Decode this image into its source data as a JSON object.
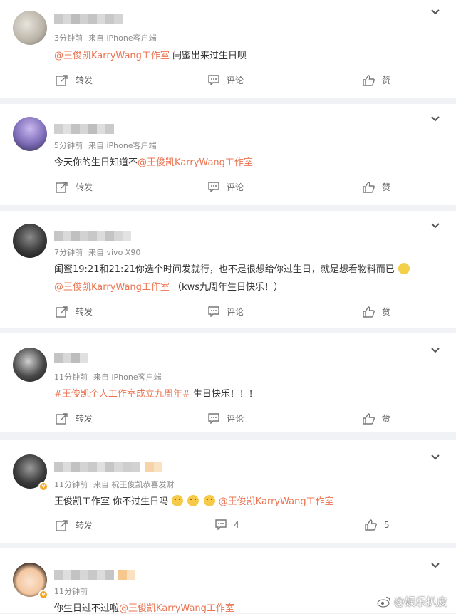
{
  "comments": [
    {
      "meta": [
        "3分钟前",
        "来自 iPhone客户端"
      ],
      "mention": "@王俊凯KarryWang工作室",
      "text_after": " 闺蜜出来过生日呗",
      "repost": "转发",
      "comment": "评论",
      "like": "赞"
    },
    {
      "meta": [
        "5分钟前",
        "来自 iPhone客户端"
      ],
      "text_before": "今天你的生日知道不",
      "mention": "@王俊凯KarryWang工作室",
      "repost": "转发",
      "comment": "评论",
      "like": "赞"
    },
    {
      "meta": [
        "7分钟前",
        "来自 vivo X90"
      ],
      "line1": "闺蜜19:21和21:21你选个时间发就行，也不是很想给你过生日，就是想看物料而已",
      "mention": "@王俊凯KarryWang工作室",
      "text_after": " （kws九周年生日快乐！）",
      "repost": "转发",
      "comment": "评论",
      "like": "赞"
    },
    {
      "meta": [
        "11分钟前",
        "来自 iPhone客户端"
      ],
      "tag": "#王俊凯个人工作室成立九周年#",
      "text_after": " 生日快乐！！！",
      "repost": "转发",
      "comment": "评论",
      "like": "赞"
    },
    {
      "meta": [
        "11分钟前",
        "来自 祝王俊凯恭喜发财"
      ],
      "text_before": "王俊凯工作室 你不过生日吗",
      "mention": "@王俊凯KarryWang工作室",
      "repost": "转发",
      "comment_count": "4",
      "like_count": "5"
    },
    {
      "meta": [
        "11分钟前"
      ],
      "text_before": "你生日过不过啦",
      "mention": "@王俊凯KarryWang工作室"
    }
  ],
  "watermark": "@娱乐扒皮",
  "colors": {
    "accent": "#eb7350",
    "background": "#f1f2f5"
  }
}
